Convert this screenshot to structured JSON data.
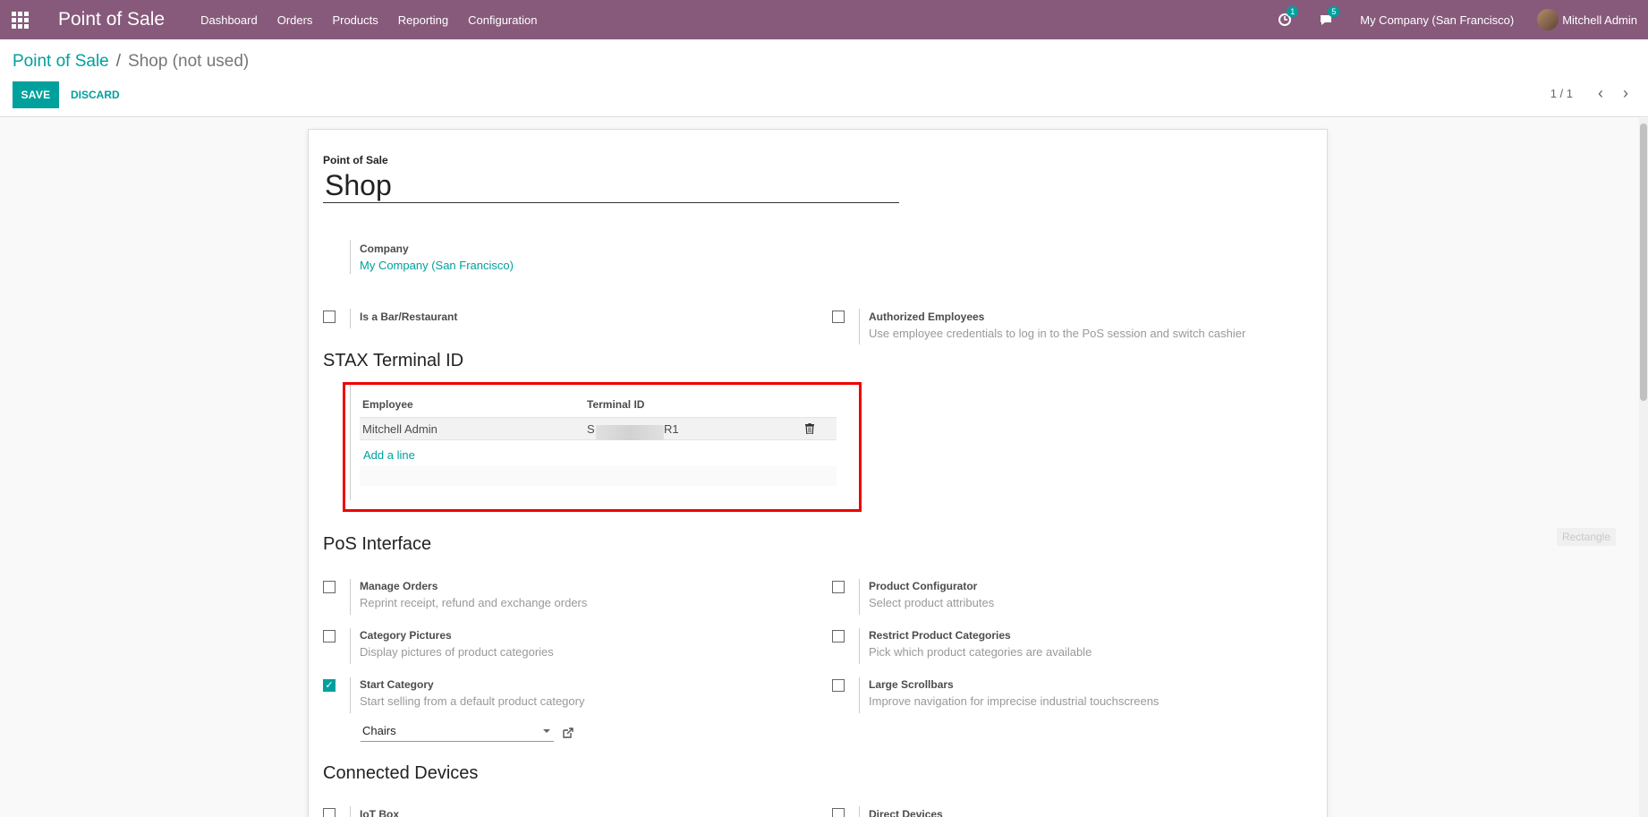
{
  "navbar": {
    "app_title": "Point of Sale",
    "menu": [
      "Dashboard",
      "Orders",
      "Products",
      "Reporting",
      "Configuration"
    ],
    "activity_count": "1",
    "message_count": "5",
    "company": "My Company (San Francisco)",
    "user": "Mitchell Admin",
    "color": "#875a7b"
  },
  "breadcrumb": {
    "parent": "Point of Sale",
    "separator": "/",
    "current": "Shop (not used)"
  },
  "buttons": {
    "save": "SAVE",
    "discard": "DISCARD"
  },
  "pager": {
    "value": "1 / 1",
    "prev": "‹",
    "next": "›"
  },
  "form": {
    "name_label": "Point of Sale",
    "name": "Shop",
    "company_label": "Company",
    "company_value": "My Company (San Francisco)",
    "is_bar_label": "Is a Bar/Restaurant",
    "is_bar_checked": false,
    "authorized_label": "Authorized Employees",
    "authorized_help": "Use employee credentials to log in to the PoS session and switch cashier",
    "authorized_checked": false,
    "stax_title": "STAX Terminal ID",
    "stax_table": {
      "headers": [
        "Employee",
        "Terminal ID"
      ],
      "rows": [
        {
          "employee": "Mitchell Admin",
          "terminal_prefix": "S",
          "terminal_suffix": "R1"
        }
      ],
      "add_line": "Add a line"
    },
    "pos_interface_title": "PoS Interface",
    "options_left": [
      {
        "label": "Manage Orders",
        "help": "Reprint receipt, refund and exchange orders",
        "checked": false
      },
      {
        "label": "Category Pictures",
        "help": "Display pictures of product categories",
        "checked": false
      },
      {
        "label": "Start Category",
        "help": "Start selling from a default product category",
        "checked": true
      }
    ],
    "options_right": [
      {
        "label": "Product Configurator",
        "help": "Select product attributes",
        "checked": false
      },
      {
        "label": "Restrict Product Categories",
        "help": "Pick which product categories are available",
        "checked": false
      },
      {
        "label": "Large Scrollbars",
        "help": "Improve navigation for imprecise industrial touchscreens",
        "checked": false
      }
    ],
    "start_category_value": "Chairs",
    "connected_devices_title": "Connected Devices",
    "iot_box_label": "IoT Box",
    "direct_devices_label": "Direct Devices"
  },
  "overlay": {
    "rectangle_label": "Rectangle",
    "highlight_color": "#ee0000"
  }
}
